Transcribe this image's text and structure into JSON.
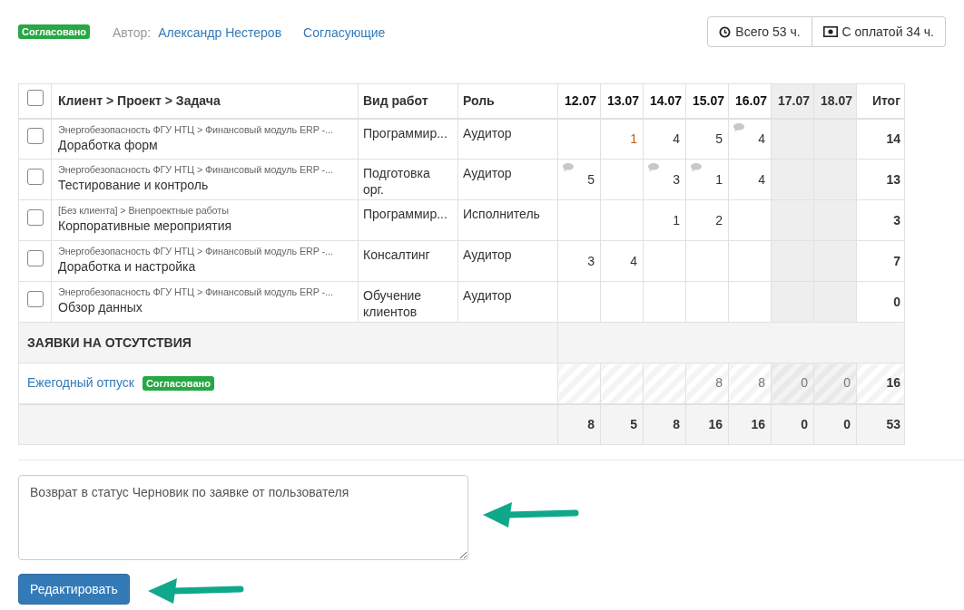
{
  "header": {
    "status_badge": "Согласовано",
    "author_label": "Автор:",
    "author_name": "Александр Нестеров",
    "approvers_link": "Согласующие",
    "totals": [
      {
        "kind": "clock",
        "text": "Всего 53 ч."
      },
      {
        "kind": "money",
        "text": "С оплатой 34 ч."
      }
    ]
  },
  "table": {
    "columns": {
      "select_all_checked": false,
      "task": "Клиент > Проект > Задача",
      "work_type": "Вид работ",
      "role": "Роль",
      "total": "Итог",
      "days": [
        {
          "label": "12.07",
          "weekend": false
        },
        {
          "label": "13.07",
          "weekend": false
        },
        {
          "label": "14.07",
          "weekend": false
        },
        {
          "label": "15.07",
          "weekend": false
        },
        {
          "label": "16.07",
          "weekend": false
        },
        {
          "label": "17.07",
          "weekend": true
        },
        {
          "label": "18.07",
          "weekend": true
        }
      ]
    },
    "rows": [
      {
        "checked": false,
        "path": "Энергобезопасность ФГУ НТЦ > Финансовый модуль ERP -...",
        "task": "Доработка форм",
        "work_type": "Программир...",
        "role": "Аудитор",
        "cells": [
          {
            "comment": false
          },
          {
            "value": "1",
            "comment": false
          },
          {
            "value": "4",
            "comment": false
          },
          {
            "value": "5",
            "comment": false
          },
          {
            "value": "4",
            "comment": true
          },
          {
            "comment": false
          },
          {
            "comment": false
          }
        ],
        "total": "14"
      },
      {
        "checked": false,
        "path": "Энергобезопасность ФГУ НТЦ > Финансовый модуль ERP -...",
        "task": "Тестирование и контроль",
        "work_type": "Подготовка орг.",
        "role": "Аудитор",
        "cells": [
          {
            "value": "5",
            "comment": true
          },
          {
            "comment": false
          },
          {
            "value": "3",
            "comment": true
          },
          {
            "value": "1",
            "comment": true
          },
          {
            "value": "4",
            "comment": false
          },
          {
            "comment": false
          },
          {
            "comment": false
          }
        ],
        "total": "13"
      },
      {
        "checked": false,
        "path": "[Без клиента] > Внепроектные работы",
        "task": "Корпоративные мероприятия",
        "work_type": "Программир...",
        "role": "Исполнитель",
        "cells": [
          {
            "comment": false
          },
          {
            "comment": false
          },
          {
            "value": "1",
            "comment": false
          },
          {
            "value": "2",
            "comment": false
          },
          {
            "comment": false
          },
          {
            "comment": false
          },
          {
            "comment": false
          }
        ],
        "total": "3"
      },
      {
        "checked": false,
        "path": "Энергобезопасность ФГУ НТЦ > Финансовый модуль ERP -...",
        "task": "Доработка и настройка",
        "work_type": "Консалтинг",
        "role": "Аудитор",
        "cells": [
          {
            "value": "3",
            "comment": false
          },
          {
            "value": "4",
            "comment": false
          },
          {
            "comment": false
          },
          {
            "comment": false
          },
          {
            "comment": false
          },
          {
            "comment": false
          },
          {
            "comment": false
          }
        ],
        "total": "7"
      },
      {
        "checked": false,
        "path": "Энергобезопасность ФГУ НТЦ > Финансовый модуль ERP -...",
        "task": "Обзор данных",
        "work_type": "Обучение клиентов",
        "role": "Аудитор",
        "cells": [
          {
            "comment": false
          },
          {
            "comment": false
          },
          {
            "comment": false
          },
          {
            "comment": false
          },
          {
            "comment": false
          },
          {
            "comment": false
          },
          {
            "comment": false
          }
        ],
        "total": "0"
      }
    ],
    "absence": {
      "title": "ЗАЯВКИ НА ОТСУТСТВИЯ",
      "rows": [
        {
          "name": "Ежегодный отпуск",
          "badge": "Согласовано",
          "cells": [
            {},
            {},
            {},
            {
              "value": "8"
            },
            {
              "value": "8"
            },
            {
              "value": "0"
            },
            {
              "value": "0"
            }
          ],
          "total": "16"
        }
      ]
    },
    "totals_row": {
      "cells": [
        "8",
        "5",
        "8",
        "16",
        "16",
        "0",
        "0"
      ],
      "total": "53"
    }
  },
  "comment": {
    "value": "Возврат в статус Черновик по заявке от пользователя"
  },
  "edit_button": "Редактировать"
}
